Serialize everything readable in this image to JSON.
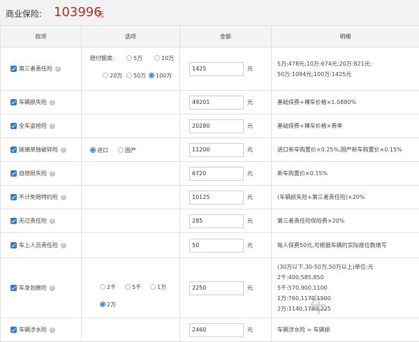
{
  "header": {
    "label": "商业保险:",
    "amount": "103996",
    "unit": "元"
  },
  "columns": [
    "款项",
    "选项",
    "金额",
    "明细"
  ],
  "unit": "元",
  "third_party": {
    "name": "第三者责任险",
    "option_label": "赔付额度:",
    "options": [
      "5万",
      "10万",
      "20万",
      "50万",
      "100万"
    ],
    "selected": "100万",
    "amount": "1425",
    "detail": [
      "5万:478元;10万:674元;20万:821元;",
      "50万:1094元;100万:1425元"
    ]
  },
  "rows": [
    {
      "name": "车辆损失险",
      "amount": "49201",
      "detail": "基础保费+裸车价格×1.0880%"
    },
    {
      "name": "全车盗抢险",
      "amount": "20280",
      "detail": "基础保费+裸车价格×费率"
    },
    {
      "name": "玻璃单独破碎险",
      "options": [
        "进口",
        "国产"
      ],
      "selected": "进口",
      "amount": "11200",
      "detail": "进口新车购置价×0.25%,国产新车购置价×0.15%"
    },
    {
      "name": "自燃损失险",
      "amount": "6720",
      "detail": "新车购置价×0.15%"
    },
    {
      "name": "不计免赔特约险",
      "amount": "10125",
      "detail": "(车辆损失险+第三者责任险)×20%"
    },
    {
      "name": "无过责任险",
      "amount": "285",
      "detail": "第三者责任险保险费×20%"
    },
    {
      "name": "车上人员责任险",
      "amount": "50",
      "detail": "每人保费50元,可根据车辆的实际座位数填写"
    }
  ],
  "scratch": {
    "name": "车身划痕险",
    "options": [
      "2千",
      "5千",
      "1万",
      "2万"
    ],
    "selected": "2万",
    "amount": "2250",
    "detail": [
      "(30万以下,30-50万,50万以上)单位:元",
      "2千:400,585,850",
      "5千:570,900,1100",
      "1万:760,1170,1500",
      "2万:1140,1780,225"
    ]
  },
  "water": {
    "name": "车辆涉水险",
    "amount": "2460",
    "detail": "车辆涉水险 = 车辆损"
  },
  "watermark": "车"
}
